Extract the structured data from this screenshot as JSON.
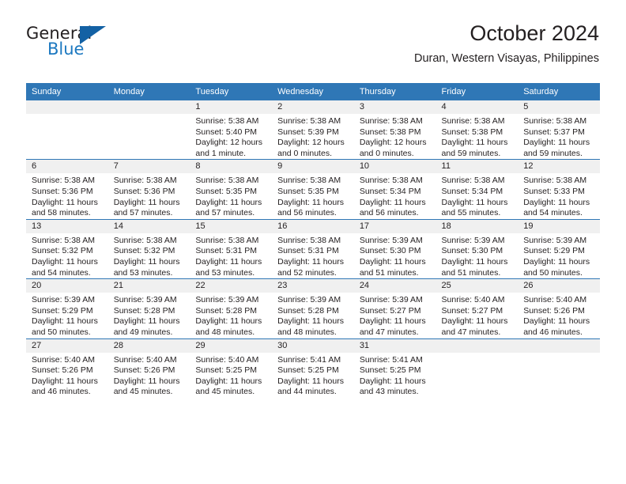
{
  "brand": {
    "name_part1": "General",
    "name_part2": "Blue",
    "triangle_color": "#1361a4",
    "blue_color": "#1c78c0"
  },
  "header": {
    "title": "October 2024",
    "subtitle": "Duran, Western Visayas, Philippines"
  },
  "theme": {
    "header_blue": "#2f77b6",
    "daynum_band": "#f0f0f0",
    "text": "#231f20"
  },
  "calendar": {
    "weekday_headers": [
      "Sunday",
      "Monday",
      "Tuesday",
      "Wednesday",
      "Thursday",
      "Friday",
      "Saturday"
    ],
    "labels": {
      "sunrise": "Sunrise:",
      "sunset": "Sunset:",
      "daylight": "Daylight:"
    },
    "weeks": [
      [
        {
          "day": "",
          "empty": true
        },
        {
          "day": "",
          "empty": true
        },
        {
          "day": "1",
          "sunrise": "Sunrise: 5:38 AM",
          "sunset": "Sunset: 5:40 PM",
          "daylight": "Daylight: 12 hours and 1 minute."
        },
        {
          "day": "2",
          "sunrise": "Sunrise: 5:38 AM",
          "sunset": "Sunset: 5:39 PM",
          "daylight": "Daylight: 12 hours and 0 minutes."
        },
        {
          "day": "3",
          "sunrise": "Sunrise: 5:38 AM",
          "sunset": "Sunset: 5:38 PM",
          "daylight": "Daylight: 12 hours and 0 minutes."
        },
        {
          "day": "4",
          "sunrise": "Sunrise: 5:38 AM",
          "sunset": "Sunset: 5:38 PM",
          "daylight": "Daylight: 11 hours and 59 minutes."
        },
        {
          "day": "5",
          "sunrise": "Sunrise: 5:38 AM",
          "sunset": "Sunset: 5:37 PM",
          "daylight": "Daylight: 11 hours and 59 minutes."
        }
      ],
      [
        {
          "day": "6",
          "sunrise": "Sunrise: 5:38 AM",
          "sunset": "Sunset: 5:36 PM",
          "daylight": "Daylight: 11 hours and 58 minutes."
        },
        {
          "day": "7",
          "sunrise": "Sunrise: 5:38 AM",
          "sunset": "Sunset: 5:36 PM",
          "daylight": "Daylight: 11 hours and 57 minutes."
        },
        {
          "day": "8",
          "sunrise": "Sunrise: 5:38 AM",
          "sunset": "Sunset: 5:35 PM",
          "daylight": "Daylight: 11 hours and 57 minutes."
        },
        {
          "day": "9",
          "sunrise": "Sunrise: 5:38 AM",
          "sunset": "Sunset: 5:35 PM",
          "daylight": "Daylight: 11 hours and 56 minutes."
        },
        {
          "day": "10",
          "sunrise": "Sunrise: 5:38 AM",
          "sunset": "Sunset: 5:34 PM",
          "daylight": "Daylight: 11 hours and 56 minutes."
        },
        {
          "day": "11",
          "sunrise": "Sunrise: 5:38 AM",
          "sunset": "Sunset: 5:34 PM",
          "daylight": "Daylight: 11 hours and 55 minutes."
        },
        {
          "day": "12",
          "sunrise": "Sunrise: 5:38 AM",
          "sunset": "Sunset: 5:33 PM",
          "daylight": "Daylight: 11 hours and 54 minutes."
        }
      ],
      [
        {
          "day": "13",
          "sunrise": "Sunrise: 5:38 AM",
          "sunset": "Sunset: 5:32 PM",
          "daylight": "Daylight: 11 hours and 54 minutes."
        },
        {
          "day": "14",
          "sunrise": "Sunrise: 5:38 AM",
          "sunset": "Sunset: 5:32 PM",
          "daylight": "Daylight: 11 hours and 53 minutes."
        },
        {
          "day": "15",
          "sunrise": "Sunrise: 5:38 AM",
          "sunset": "Sunset: 5:31 PM",
          "daylight": "Daylight: 11 hours and 53 minutes."
        },
        {
          "day": "16",
          "sunrise": "Sunrise: 5:38 AM",
          "sunset": "Sunset: 5:31 PM",
          "daylight": "Daylight: 11 hours and 52 minutes."
        },
        {
          "day": "17",
          "sunrise": "Sunrise: 5:39 AM",
          "sunset": "Sunset: 5:30 PM",
          "daylight": "Daylight: 11 hours and 51 minutes."
        },
        {
          "day": "18",
          "sunrise": "Sunrise: 5:39 AM",
          "sunset": "Sunset: 5:30 PM",
          "daylight": "Daylight: 11 hours and 51 minutes."
        },
        {
          "day": "19",
          "sunrise": "Sunrise: 5:39 AM",
          "sunset": "Sunset: 5:29 PM",
          "daylight": "Daylight: 11 hours and 50 minutes."
        }
      ],
      [
        {
          "day": "20",
          "sunrise": "Sunrise: 5:39 AM",
          "sunset": "Sunset: 5:29 PM",
          "daylight": "Daylight: 11 hours and 50 minutes."
        },
        {
          "day": "21",
          "sunrise": "Sunrise: 5:39 AM",
          "sunset": "Sunset: 5:28 PM",
          "daylight": "Daylight: 11 hours and 49 minutes."
        },
        {
          "day": "22",
          "sunrise": "Sunrise: 5:39 AM",
          "sunset": "Sunset: 5:28 PM",
          "daylight": "Daylight: 11 hours and 48 minutes."
        },
        {
          "day": "23",
          "sunrise": "Sunrise: 5:39 AM",
          "sunset": "Sunset: 5:28 PM",
          "daylight": "Daylight: 11 hours and 48 minutes."
        },
        {
          "day": "24",
          "sunrise": "Sunrise: 5:39 AM",
          "sunset": "Sunset: 5:27 PM",
          "daylight": "Daylight: 11 hours and 47 minutes."
        },
        {
          "day": "25",
          "sunrise": "Sunrise: 5:40 AM",
          "sunset": "Sunset: 5:27 PM",
          "daylight": "Daylight: 11 hours and 47 minutes."
        },
        {
          "day": "26",
          "sunrise": "Sunrise: 5:40 AM",
          "sunset": "Sunset: 5:26 PM",
          "daylight": "Daylight: 11 hours and 46 minutes."
        }
      ],
      [
        {
          "day": "27",
          "sunrise": "Sunrise: 5:40 AM",
          "sunset": "Sunset: 5:26 PM",
          "daylight": "Daylight: 11 hours and 46 minutes."
        },
        {
          "day": "28",
          "sunrise": "Sunrise: 5:40 AM",
          "sunset": "Sunset: 5:26 PM",
          "daylight": "Daylight: 11 hours and 45 minutes."
        },
        {
          "day": "29",
          "sunrise": "Sunrise: 5:40 AM",
          "sunset": "Sunset: 5:25 PM",
          "daylight": "Daylight: 11 hours and 45 minutes."
        },
        {
          "day": "30",
          "sunrise": "Sunrise: 5:41 AM",
          "sunset": "Sunset: 5:25 PM",
          "daylight": "Daylight: 11 hours and 44 minutes."
        },
        {
          "day": "31",
          "sunrise": "Sunrise: 5:41 AM",
          "sunset": "Sunset: 5:25 PM",
          "daylight": "Daylight: 11 hours and 43 minutes."
        },
        {
          "day": "",
          "empty": true
        },
        {
          "day": "",
          "empty": true
        }
      ]
    ]
  }
}
